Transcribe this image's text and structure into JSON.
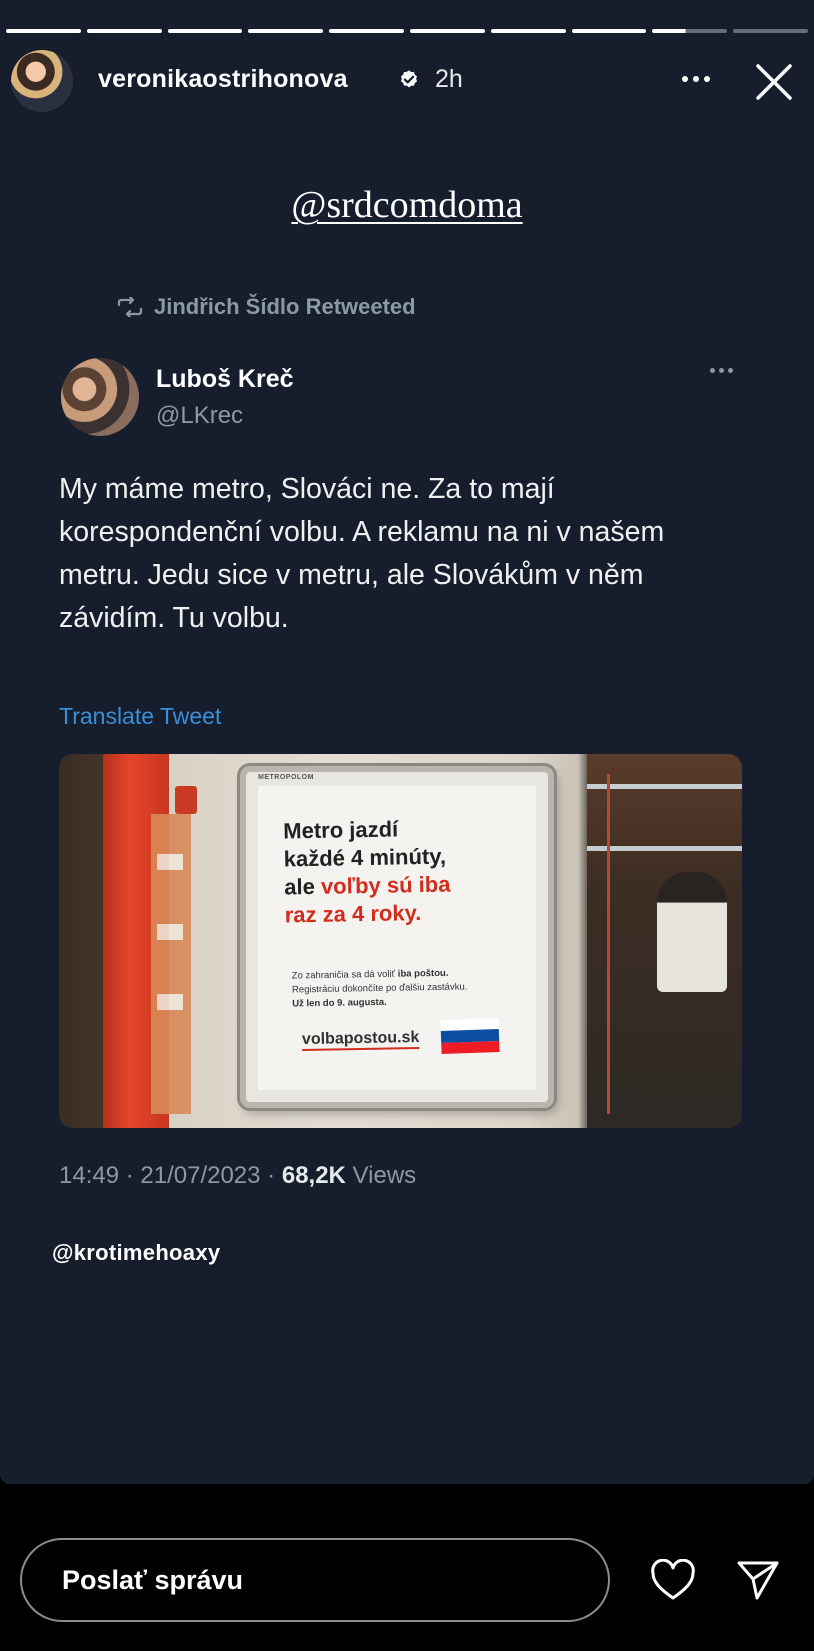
{
  "story": {
    "progress": {
      "total": 10,
      "completed": 8,
      "current_fraction": 0.45
    },
    "user": {
      "username": "veronikaostrihonova",
      "time": "2h"
    },
    "mention_top": "@srdcomdoma",
    "mention_bottom": "@krotimehoaxy"
  },
  "tweet": {
    "retweeted_by": "Jindřich Šídlo Retweeted",
    "author_name": "Luboš Kreč",
    "author_handle": "@LKrec",
    "text": "My máme metro, Slováci ne. Za to mají korespondenční volbu. A reklamu na ni v našem metru. Jedu sice v metru, ale Slovákům v něm závidím. Tu volbu.",
    "translate": "Translate Tweet",
    "timestamp": "14:49 · 21/07/2023 · ",
    "views_count": "68,2K",
    "views_label": " Views"
  },
  "ad": {
    "frame_tag": "METROPOLOM",
    "headline_1": "Metro jazdí",
    "headline_2": "každé 4 minúty,",
    "headline_3a": "ale ",
    "headline_3b": "voľby sú iba",
    "headline_4": "raz za 4 roky.",
    "sub_1a": "Zo zahraničia sa dá voliť ",
    "sub_1b": "iba poštou.",
    "sub_2": "Registráciu dokončíte po ďalšiu zastávku.",
    "sub_3": "Už len do 9. augusta.",
    "url": "volbapostou.sk"
  },
  "reply": {
    "placeholder": "Poslať správu"
  },
  "colors": {
    "story_bg": "#161e2e",
    "link_blue": "#3b8fd6",
    "muted": "#8b98a5",
    "ad_red": "#d22c1d"
  },
  "icons": [
    "verified-badge-icon",
    "more-icon",
    "close-icon",
    "retweet-icon",
    "heart-icon",
    "send-icon"
  ]
}
